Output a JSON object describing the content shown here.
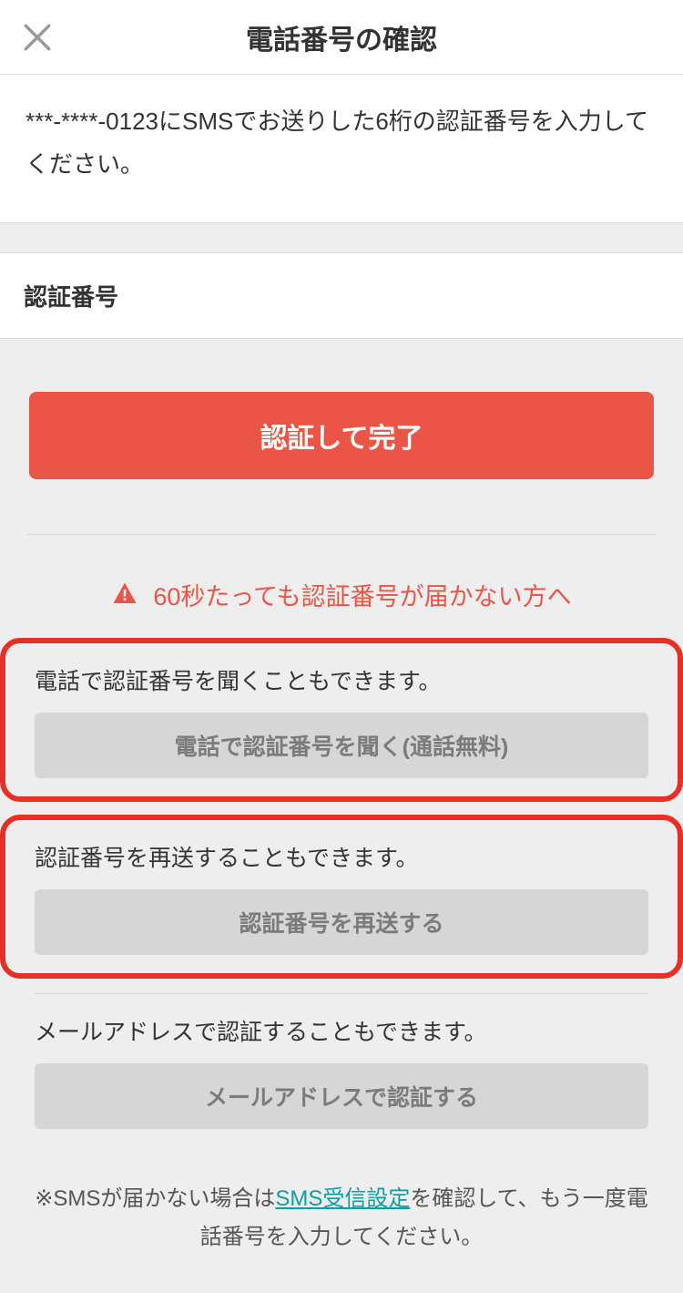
{
  "header": {
    "title": "電話番号の確認"
  },
  "instruction": "***-****-0123にSMSでお送りした6桁の認証番号を入力してください。",
  "input_label": "認証番号",
  "primary_button": "認証して完了",
  "warning_text": "60秒たっても認証番号が届かない方へ",
  "phone_box": {
    "label": "電話で認証番号を聞くこともできます。",
    "button": "電話で認証番号を聞く(通話無料)"
  },
  "resend_box": {
    "label": "認証番号を再送することもできます。",
    "button": "認証番号を再送する"
  },
  "email_section": {
    "label": "メールアドレスで認証することもできます。",
    "button": "メールアドレスで認証する"
  },
  "footnote": {
    "prefix": "※SMSが届かない場合は",
    "link": "SMS受信設定",
    "suffix": "を確認して、もう一度電話番号を入力してください。"
  }
}
